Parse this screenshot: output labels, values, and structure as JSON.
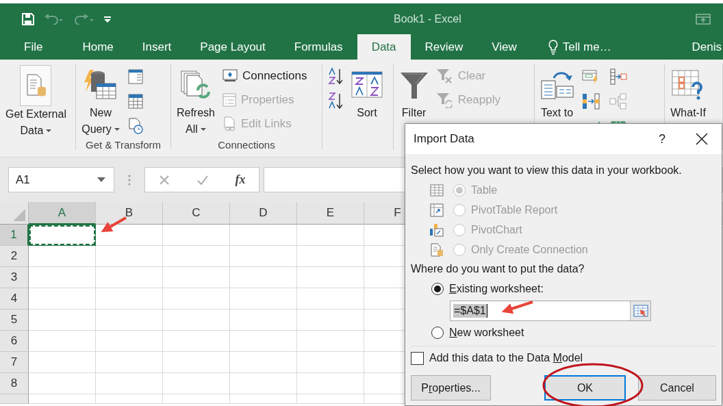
{
  "window": {
    "title": "Book1 - Excel"
  },
  "tabs": [
    {
      "label": "File",
      "selected": false
    },
    {
      "label": "Home",
      "selected": false
    },
    {
      "label": "Insert",
      "selected": false
    },
    {
      "label": "Page Layout",
      "selected": false
    },
    {
      "label": "Formulas",
      "selected": false
    },
    {
      "label": "Data",
      "selected": true
    },
    {
      "label": "Review",
      "selected": false
    },
    {
      "label": "View",
      "selected": false
    }
  ],
  "tell_me": "Tell me…",
  "user": "Denis",
  "ribbon": {
    "groups": [
      {
        "items": [
          {
            "kind": "large",
            "lines": [
              "Get External",
              "Data"
            ],
            "dropdown": true
          }
        ]
      },
      {
        "label": "Get & Transform",
        "items": [
          {
            "kind": "large",
            "lines": [
              "New",
              "Query"
            ],
            "dropdown": true
          },
          {
            "kind": "icon"
          },
          {
            "kind": "icon"
          },
          {
            "kind": "icon"
          }
        ]
      },
      {
        "label": "Connections",
        "items": [
          {
            "kind": "large",
            "lines": [
              "Refresh",
              "All"
            ],
            "dropdown": true
          },
          {
            "kind": "small",
            "label": "Connections",
            "disabled": false
          },
          {
            "kind": "small",
            "label": "Properties",
            "disabled": true
          },
          {
            "kind": "small",
            "label": "Edit Links",
            "disabled": true
          }
        ]
      },
      {
        "items": [
          {
            "kind": "icon"
          },
          {
            "kind": "icon"
          },
          {
            "kind": "large",
            "lines": [
              "Sort"
            ],
            "dropdown": false
          }
        ]
      },
      {
        "items": [
          {
            "kind": "large",
            "lines": [
              "Filter"
            ],
            "dropdown": false
          },
          {
            "kind": "small",
            "label": "Clear",
            "disabled": true
          },
          {
            "kind": "small",
            "label": "Reapply",
            "disabled": true
          }
        ]
      },
      {
        "items": [
          {
            "kind": "large",
            "lines": [
              "Text to"
            ],
            "dropdown": false
          },
          {
            "kind": "icon"
          },
          {
            "kind": "icon"
          },
          {
            "kind": "icon"
          },
          {
            "kind": "icon"
          },
          {
            "kind": "icon"
          },
          {
            "kind": "icon"
          }
        ]
      },
      {
        "items": [
          {
            "kind": "large",
            "lines": [
              "What-If"
            ],
            "dropdown": false
          }
        ]
      }
    ]
  },
  "formula_bar": {
    "name_box": "A1",
    "function_label": "fx"
  },
  "sheet": {
    "columns": [
      {
        "label": "A",
        "selected": true
      },
      {
        "label": "B",
        "selected": false
      },
      {
        "label": "C",
        "selected": false
      },
      {
        "label": "D",
        "selected": false
      },
      {
        "label": "E",
        "selected": false
      },
      {
        "label": "F",
        "selected": false
      }
    ],
    "rows": [
      {
        "label": "1",
        "selected": true
      },
      {
        "label": "2",
        "selected": false
      },
      {
        "label": "3",
        "selected": false
      },
      {
        "label": "4",
        "selected": false
      },
      {
        "label": "5",
        "selected": false
      },
      {
        "label": "6",
        "selected": false
      },
      {
        "label": "7",
        "selected": false
      },
      {
        "label": "8",
        "selected": false
      }
    ]
  },
  "dialog": {
    "title": "Import Data",
    "help": "?",
    "view_prompt": "Select how you want to view this data in your workbook.",
    "view_options": [
      {
        "label": "Table",
        "selected": true,
        "disabled": true
      },
      {
        "label": "PivotTable Report",
        "selected": false,
        "disabled": true
      },
      {
        "label": "PivotChart",
        "selected": false,
        "disabled": true
      },
      {
        "label": "Only Create Connection",
        "selected": false,
        "disabled": true
      }
    ],
    "place_prompt": "Where do you want to put the data?",
    "place_options": [
      {
        "access_key": "E",
        "text_after": "xisting worksheet:",
        "selected": true
      },
      {
        "access_key": "N",
        "text_after": "ew worksheet",
        "selected": false
      }
    ],
    "location": {
      "value": "=$A$1"
    },
    "data_model": {
      "text_before": "Add this data to the Data ",
      "access_key": "M",
      "text_after": "odel",
      "checked": false
    },
    "buttons": [
      {
        "text_before": "P",
        "access_key": "r",
        "text_after": "operties...",
        "focused": false
      },
      {
        "text_before": "OK",
        "focused": true
      },
      {
        "text_before": "Cancel",
        "focused": false
      }
    ]
  }
}
